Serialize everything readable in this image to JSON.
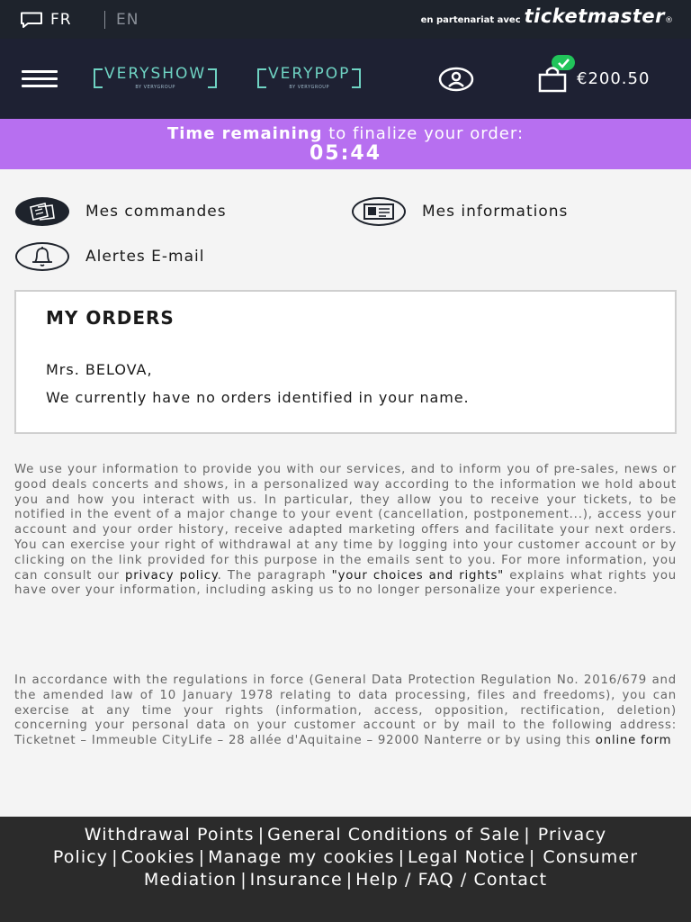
{
  "topbar": {
    "lang_fr": "FR",
    "lang_en": "EN",
    "partner_prefix": "en partenariat avec",
    "partner_brand": "ticketmaster",
    "partner_mark": "®"
  },
  "header": {
    "logo_veryshow": "VERYSHOW",
    "logo_veryshow_sub": "BY VERYGROUP",
    "logo_verypop": "VERYPOP",
    "logo_verypop_sub": "BY VERYGROUP",
    "cart_amount": "€200.50"
  },
  "timer": {
    "label_bold": "Time remaining",
    "label_rest": "to finalize your order:",
    "clock": "05:44"
  },
  "account_menu": {
    "orders": "Mes commandes",
    "info": "Mes informations",
    "alerts": "Alertes E-mail"
  },
  "orders": {
    "title": "MY ORDERS",
    "greeting": "Mrs. BELOVA,",
    "message": "We currently have no orders identified in your name."
  },
  "legal": {
    "p1_a": "We use your information to provide you with our services, and to inform you of pre-sales, news or good deals concerts and shows, in a personalized way according to the information we hold about you and how you interact with us. In particular, they allow you to receive your tickets, to be notified in the event of a major change to your event (cancellation, postponement...), access your account and your order history, receive adapted marketing offers and facilitate your next orders. You can exercise your right of withdrawal at any time by logging into your customer account or by clicking on the link provided for this purpose in the emails sent to you. For more information, you can consult our",
    "privacy_link": "privacy policy",
    "p1_b": ". The paragraph",
    "choices_link": "\"your choices and rights\"",
    "p1_c": "explains what rights you have over your information, including asking us to no longer personalize your experience.",
    "p2_a": "In accordance with the regulations in force (General Data Protection Regulation No. 2016/679 and the amended law of 10 January 1978 relating to data processing, files and freedoms), you can exercise at any time your rights (information, access, opposition, rectification, deletion) concerning your personal data on your customer account or by mail to the following address: Ticketnet – Immeuble CityLife – 28 allée d'Aquitaine – 92000 Nanterre or by using this",
    "online_form_link": "online form"
  },
  "footer": {
    "links": [
      "Withdrawal Points",
      "General Conditions of Sale",
      "Privacy Policy",
      "Cookies",
      "Manage my cookies",
      "Legal Notice",
      "Consumer Mediation",
      "Insurance",
      "Help / FAQ / Contact"
    ]
  },
  "colors": {
    "topbar_bg": "#1e232c",
    "header_bg": "#1e2133",
    "timer_bg": "#b76ff0",
    "logo_accent": "#6fd3c3",
    "cart_check": "#21c45a",
    "footer_bg": "#2b2b2b"
  },
  "icons": [
    "chat-bubble-icon",
    "menu-icon",
    "user-icon",
    "shopping-bag-icon",
    "checkmark-icon",
    "tickets-icon",
    "id-card-icon",
    "bell-icon"
  ]
}
